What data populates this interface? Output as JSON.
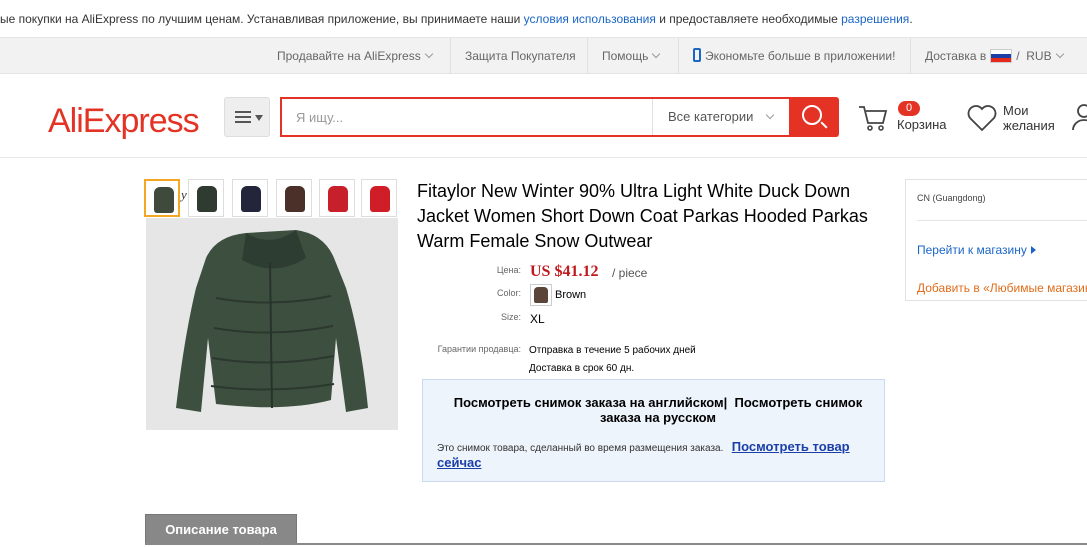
{
  "notice": {
    "text_before": "ые покупки на AliExpress по лучшим ценам. Устанавливая приложение, вы принимаете наши ",
    "terms_link": "условия использования",
    "text_middle": " и предоставляете необходимые ",
    "permissions_link": "разрешения",
    "text_after": "."
  },
  "topnav": {
    "sell": "Продавайте на AliExpress",
    "buyer_protection": "Защита Покупателя",
    "help": "Помощь",
    "app_promo": "Экономьте больше в приложении!",
    "delivery_label": "Доставка в",
    "currency_separator": "/",
    "currency": "RUB"
  },
  "header": {
    "logo": "AliExpress",
    "search_placeholder": "Я ищу...",
    "category": "Все категории",
    "cart_count": "0",
    "cart_label": "Корзина",
    "wishlist_label_1": "Мои",
    "wishlist_label_2": "желания"
  },
  "product": {
    "title": "Fitaylor New Winter 90% Ultra Light White Duck Down Jacket Women Short Down Coat Parkas Hooded Parkas Warm Female Snow Outwear",
    "thumb_caption": "y",
    "price_label": "Цена:",
    "price": "US $41.12",
    "price_unit": "/ piece",
    "color_label": "Color:",
    "color_value": "Brown",
    "size_label": "Size:",
    "size_value": "XL",
    "guarantee_label": "Гарантии продавца:",
    "guarantee_1": "Отправка в течение 5 рабочих дней",
    "guarantee_2": "Доставка в срок 60 дн.",
    "thumb_colors": [
      "#3f4a3c",
      "#2f3a30",
      "#23263a",
      "#4a3028",
      "#c8202a",
      "#d01e28"
    ],
    "main_color": "#3d5040"
  },
  "snapshot": {
    "view_english": "Посмотреть снимок заказа на английском",
    "separator": "|",
    "view_russian": "Посмотреть снимок заказа на русском",
    "note": "Это снимок товара, сделанный во время размещения заказа.",
    "view_now": "Посмотреть товар сейчас"
  },
  "seller": {
    "location": "CN (Guangdong)",
    "store_link": "Перейти к магазину",
    "favorites_link": "Добавить в «Любимые магазины»"
  },
  "tabs": {
    "description": "Описание товара"
  },
  "colors": {
    "brand": "#e43225",
    "link": "#1a66c6",
    "price": "#c0191d",
    "favorite": "#e06d1c"
  }
}
